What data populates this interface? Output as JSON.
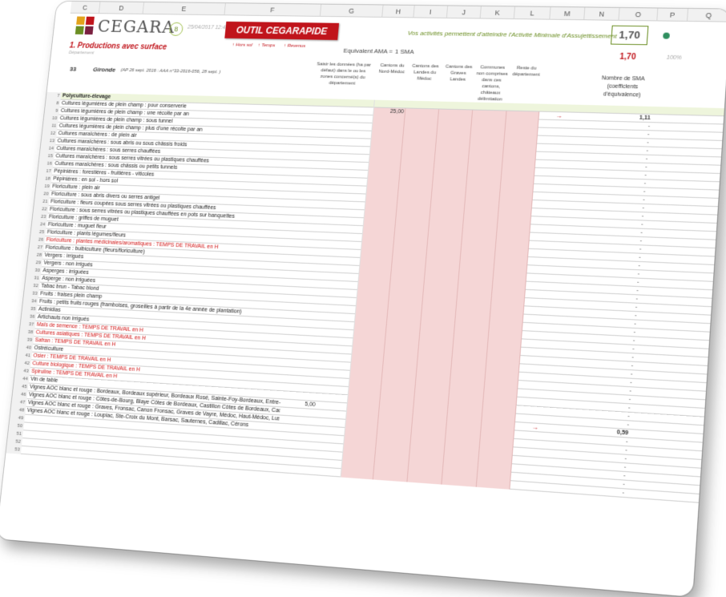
{
  "columns": [
    "C",
    "D",
    "E",
    "F",
    "G",
    "H",
    "I",
    "J",
    "K",
    "L",
    "M",
    "N",
    "O",
    "P",
    "Q"
  ],
  "header": {
    "brand": "CEGARA",
    "badge": "8",
    "date": "25/04/2017  12:46:41",
    "tool_title": "OUTIL CEGARAPIDE",
    "tool_title_bold": "AMA",
    "motto": "Vos activités permettent d'atteindre l'Activité Minimale d'Assujettissement",
    "total": "1,70"
  },
  "section": {
    "title": "1. Productions avec surface",
    "subtitle": "Département",
    "links": [
      "Hors sol",
      "Temps",
      "Revenus"
    ],
    "equiv_label": "Equivalent AMA =",
    "equiv_value": "1 SMA",
    "total": "1,70",
    "pct": "100%"
  },
  "dept": {
    "number": "33",
    "name": "Gironde",
    "ref": "(AP 26 sept. 2016 : AAA n°33-2016-056, 28 sept. )",
    "col_default": "Saisir les données (ha par défaut) dans le ou les zones concerné(s) du département",
    "col_zone1": "Cantons du Nord-Médoc",
    "col_zone2": "Cantons des Landes du Médoc",
    "col_zone3": "Cantons des Graves Landes",
    "col_zone4": "Communes non comprises dans ces cantons, châteaux délimitation",
    "col_zone5": "Reste du département",
    "sma_head": "Nombre de SMA (coefficients d'équivalence)"
  },
  "rows": [
    {
      "num": "7",
      "label": "Polyculture-élevage",
      "style": "group",
      "value": "",
      "sma": "",
      "arrow": false
    },
    {
      "num": "8",
      "label": "Cultures légumières de plein champ : pour conserverie",
      "style": "",
      "value": "25,00",
      "sma": "1,11",
      "arrow": true
    },
    {
      "num": "9",
      "label": "Cultures légumières de plein champ : une récolte par an",
      "style": "",
      "value": "",
      "sma": "-",
      "arrow": false
    },
    {
      "num": "10",
      "label": "Cultures légumières de plein champ : sous tunnel",
      "style": "",
      "value": "",
      "sma": "-",
      "arrow": false
    },
    {
      "num": "11",
      "label": "Cultures légumières de plein champ : plus d'une récolte par an",
      "style": "",
      "value": "",
      "sma": "-",
      "arrow": false
    },
    {
      "num": "12",
      "label": "Cultures maraîchères : de plein air",
      "style": "",
      "value": "",
      "sma": "-",
      "arrow": false
    },
    {
      "num": "13",
      "label": "Cultures maraîchères : sous abris ou sous châssis froids",
      "style": "",
      "value": "",
      "sma": "-",
      "arrow": false
    },
    {
      "num": "14",
      "label": "Cultures maraîchères : sous serres chauffées",
      "style": "",
      "value": "",
      "sma": "-",
      "arrow": false
    },
    {
      "num": "15",
      "label": "Cultures maraîchères : sous serres vitrées ou plastiques chauffées",
      "style": "",
      "value": "",
      "sma": "-",
      "arrow": false
    },
    {
      "num": "16",
      "label": "Cultures maraîchères : sous châssis ou petits tunnels",
      "style": "",
      "value": "",
      "sma": "-",
      "arrow": false
    },
    {
      "num": "17",
      "label": "Pépinières : forestières - fruitières - viticoles",
      "style": "",
      "value": "",
      "sma": "-",
      "arrow": false
    },
    {
      "num": "18",
      "label": "Pépinières : en sol - hors sol",
      "style": "",
      "value": "",
      "sma": "-",
      "arrow": false
    },
    {
      "num": "19",
      "label": "Floriculture : plein air",
      "style": "",
      "value": "",
      "sma": "-",
      "arrow": false
    },
    {
      "num": "20",
      "label": "Floriculture : sous abris divers ou serres antigel",
      "style": "",
      "value": "",
      "sma": "-",
      "arrow": false
    },
    {
      "num": "21",
      "label": "Floriculture : fleurs coupées sous serres vitrées ou plastiques chauffées",
      "style": "",
      "value": "",
      "sma": "-",
      "arrow": false
    },
    {
      "num": "22",
      "label": "Floriculture : sous serres vitrées ou plastiques chauffées en pots sur banquettes",
      "style": "",
      "value": "",
      "sma": "-",
      "arrow": false
    },
    {
      "num": "23",
      "label": "Floriculture : griffes de muguet",
      "style": "",
      "value": "",
      "sma": "-",
      "arrow": false
    },
    {
      "num": "24",
      "label": "Floriculture : muguet fleur",
      "style": "",
      "value": "",
      "sma": "-",
      "arrow": false
    },
    {
      "num": "25",
      "label": "Floriculture : plants légumes/fleurs",
      "style": "",
      "value": "",
      "sma": "-",
      "arrow": false
    },
    {
      "num": "26",
      "label": "Floriculture : plantes médicinales/aromatiques : TEMPS DE TRAVAIL en H",
      "style": "red",
      "value": "",
      "sma": "-",
      "arrow": false
    },
    {
      "num": "27",
      "label": "Floriculture : bulbiculture (fleurs/floriculture)",
      "style": "",
      "value": "",
      "sma": "-",
      "arrow": false
    },
    {
      "num": "28",
      "label": "Vergers : irrigués",
      "style": "",
      "value": "",
      "sma": "-",
      "arrow": false
    },
    {
      "num": "29",
      "label": "Vergers : non irrigués",
      "style": "",
      "value": "",
      "sma": "-",
      "arrow": false
    },
    {
      "num": "30",
      "label": "Asperges : irriguées",
      "style": "",
      "value": "",
      "sma": "-",
      "arrow": false
    },
    {
      "num": "31",
      "label": "Asperge : non irriguées",
      "style": "",
      "value": "",
      "sma": "-",
      "arrow": false
    },
    {
      "num": "32",
      "label": "Tabac brun - Tabac blond",
      "style": "",
      "value": "",
      "sma": "-",
      "arrow": false
    },
    {
      "num": "33",
      "label": "Fruits : fraises plein champ",
      "style": "",
      "value": "",
      "sma": "-",
      "arrow": false
    },
    {
      "num": "34",
      "label": "Fruits : petits fruits rouges (framboises, groseilles à partir de la 4e année de plantation)",
      "style": "",
      "value": "",
      "sma": "-",
      "arrow": false
    },
    {
      "num": "35",
      "label": "Actinidias",
      "style": "",
      "value": "",
      "sma": "-",
      "arrow": false
    },
    {
      "num": "36",
      "label": "Artichauts non irrigués",
      "style": "",
      "value": "",
      "sma": "-",
      "arrow": false
    },
    {
      "num": "37",
      "label": "Maïs de semence : TEMPS DE TRAVAIL en H",
      "style": "red",
      "value": "",
      "sma": "-",
      "arrow": false
    },
    {
      "num": "38",
      "label": "Cultures asiatiques : TEMPS DE TRAVAIL en H",
      "style": "red",
      "value": "",
      "sma": "-",
      "arrow": false
    },
    {
      "num": "39",
      "label": "Safran : TEMPS DE TRAVAIL en H",
      "style": "red",
      "value": "",
      "sma": "-",
      "arrow": false
    },
    {
      "num": "40",
      "label": "Ostréiculture",
      "style": "",
      "value": "",
      "sma": "-",
      "arrow": false
    },
    {
      "num": "41",
      "label": "Osier : TEMPS DE TRAVAIL en H",
      "style": "red",
      "value": "",
      "sma": "-",
      "arrow": false
    },
    {
      "num": "42",
      "label": "Culture biologique : TEMPS DE TRAVAIL en H",
      "style": "red",
      "value": "",
      "sma": "-",
      "arrow": false
    },
    {
      "num": "43",
      "label": "Spiruline : TEMPS DE TRAVAIL en H",
      "style": "red",
      "value": "",
      "sma": "-",
      "arrow": false
    },
    {
      "num": "44",
      "label": "Vin de table",
      "style": "",
      "value": "",
      "sma": "-",
      "arrow": false
    },
    {
      "num": "45",
      "label": "Vignes AOC blanc et rouge : Bordeaux, Bordeaux supérieur, Bordeaux Rosé, Sainte-Foy-Bordeaux, Entre-deux-Mers, Entre-deux...",
      "style": "",
      "value": "5,00",
      "sma": "-",
      "arrow": false
    },
    {
      "num": "46",
      "label": "Vignes AOC blanc et rouge : Côtes-de-Bourg, Blaye Côtes de Bordeaux, Castillon Côtes de Bordeaux, Cadillac-Côtes de Bordeaux",
      "style": "",
      "value": "",
      "sma": "0,59",
      "arrow": true
    },
    {
      "num": "47",
      "label": "Vignes AOC blanc et rouge : Graves, Fronsac, Canon Fronsac, Graves de Vayre, Médoc, Haut-Médoc, Lussac, Montagne, Puisseguin",
      "style": "",
      "value": "",
      "sma": "-",
      "arrow": false
    },
    {
      "num": "48",
      "label": "Vignes AOC blanc et rouge : Loupiac, Ste-Croix du Mont, Barsac, Sauternes, Cadillac, Cérons",
      "style": "",
      "value": "",
      "sma": "-",
      "arrow": false
    },
    {
      "num": "49",
      "label": "",
      "style": "",
      "value": "",
      "sma": "-",
      "arrow": false
    },
    {
      "num": "50",
      "label": "",
      "style": "",
      "value": "",
      "sma": "-",
      "arrow": false
    },
    {
      "num": "51",
      "label": "",
      "style": "",
      "value": "",
      "sma": "-",
      "arrow": false
    },
    {
      "num": "52",
      "label": "",
      "style": "",
      "value": "",
      "sma": "-",
      "arrow": false
    },
    {
      "num": "53",
      "label": "",
      "style": "",
      "value": "",
      "sma": "-",
      "arrow": false
    }
  ],
  "colors": {
    "accent_red": "#c0141b",
    "accent_green": "#6b8e23",
    "pink_cell": "#f5d6d6",
    "group_row": "#eef5dc"
  }
}
